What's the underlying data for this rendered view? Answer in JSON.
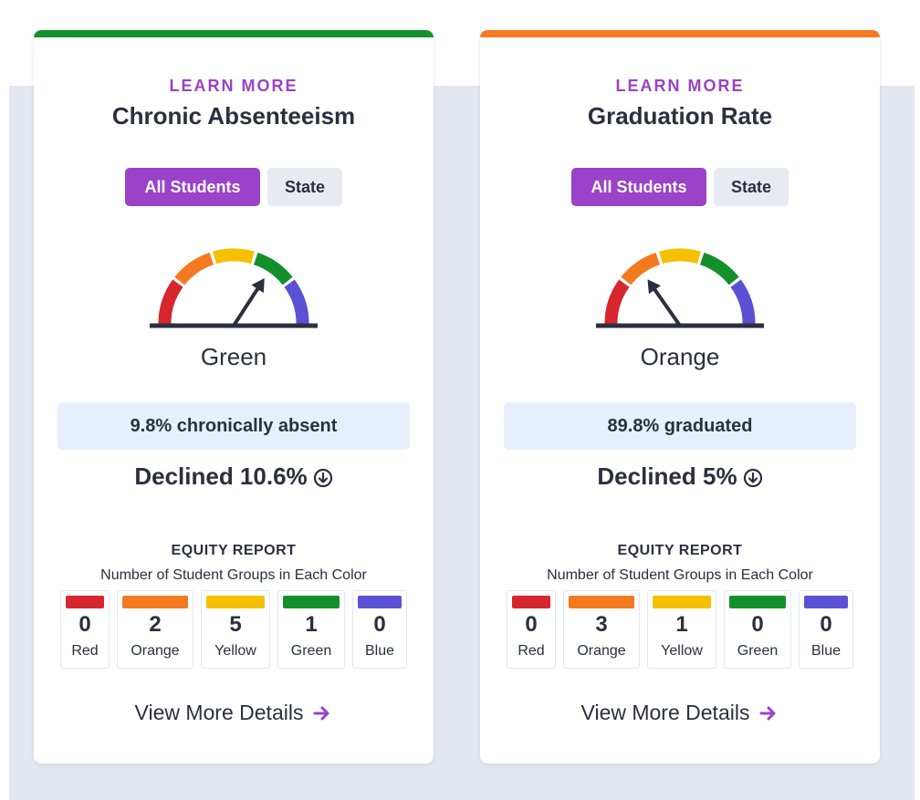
{
  "colors": {
    "red": "#d6262e",
    "orange": "#f47a20",
    "yellow": "#f5c000",
    "green": "#13902c",
    "blue": "#5a51d4",
    "purple": "#9a42c8",
    "accent_green": "#13902c",
    "accent_orange": "#f47a20"
  },
  "cards": [
    {
      "learn_more": "LEARN MORE",
      "title": "Chronic Absenteeism",
      "toggle": {
        "all_students": "All Students",
        "state": "State",
        "selected": "All Students"
      },
      "gauge": {
        "level": "Green",
        "needle_angle_deg": 57
      },
      "status_label": "Green",
      "stat": "9.8% chronically absent",
      "change": "Declined 10.6%",
      "change_icon": "arrow-down-circle-icon",
      "equity": {
        "title": "EQUITY REPORT",
        "subtitle": "Number of Student Groups in Each Color",
        "tiles": [
          {
            "label": "Red",
            "count": "0"
          },
          {
            "label": "Orange",
            "count": "2"
          },
          {
            "label": "Yellow",
            "count": "5"
          },
          {
            "label": "Green",
            "count": "1"
          },
          {
            "label": "Blue",
            "count": "0"
          }
        ]
      },
      "details_link": "View More Details",
      "details_icon": "arrow-right-icon"
    },
    {
      "learn_more": "LEARN MORE",
      "title": "Graduation Rate",
      "toggle": {
        "all_students": "All Students",
        "state": "State",
        "selected": "All Students"
      },
      "gauge": {
        "level": "Orange",
        "needle_angle_deg": 125
      },
      "status_label": "Orange",
      "stat": "89.8% graduated",
      "change": "Declined 5%",
      "change_icon": "arrow-down-circle-icon",
      "equity": {
        "title": "EQUITY REPORT",
        "subtitle": "Number of Student Groups in Each Color",
        "tiles": [
          {
            "label": "Red",
            "count": "0"
          },
          {
            "label": "Orange",
            "count": "3"
          },
          {
            "label": "Yellow",
            "count": "1"
          },
          {
            "label": "Green",
            "count": "0"
          },
          {
            "label": "Blue",
            "count": "0"
          }
        ]
      },
      "details_link": "View More Details",
      "details_icon": "arrow-right-icon"
    }
  ]
}
